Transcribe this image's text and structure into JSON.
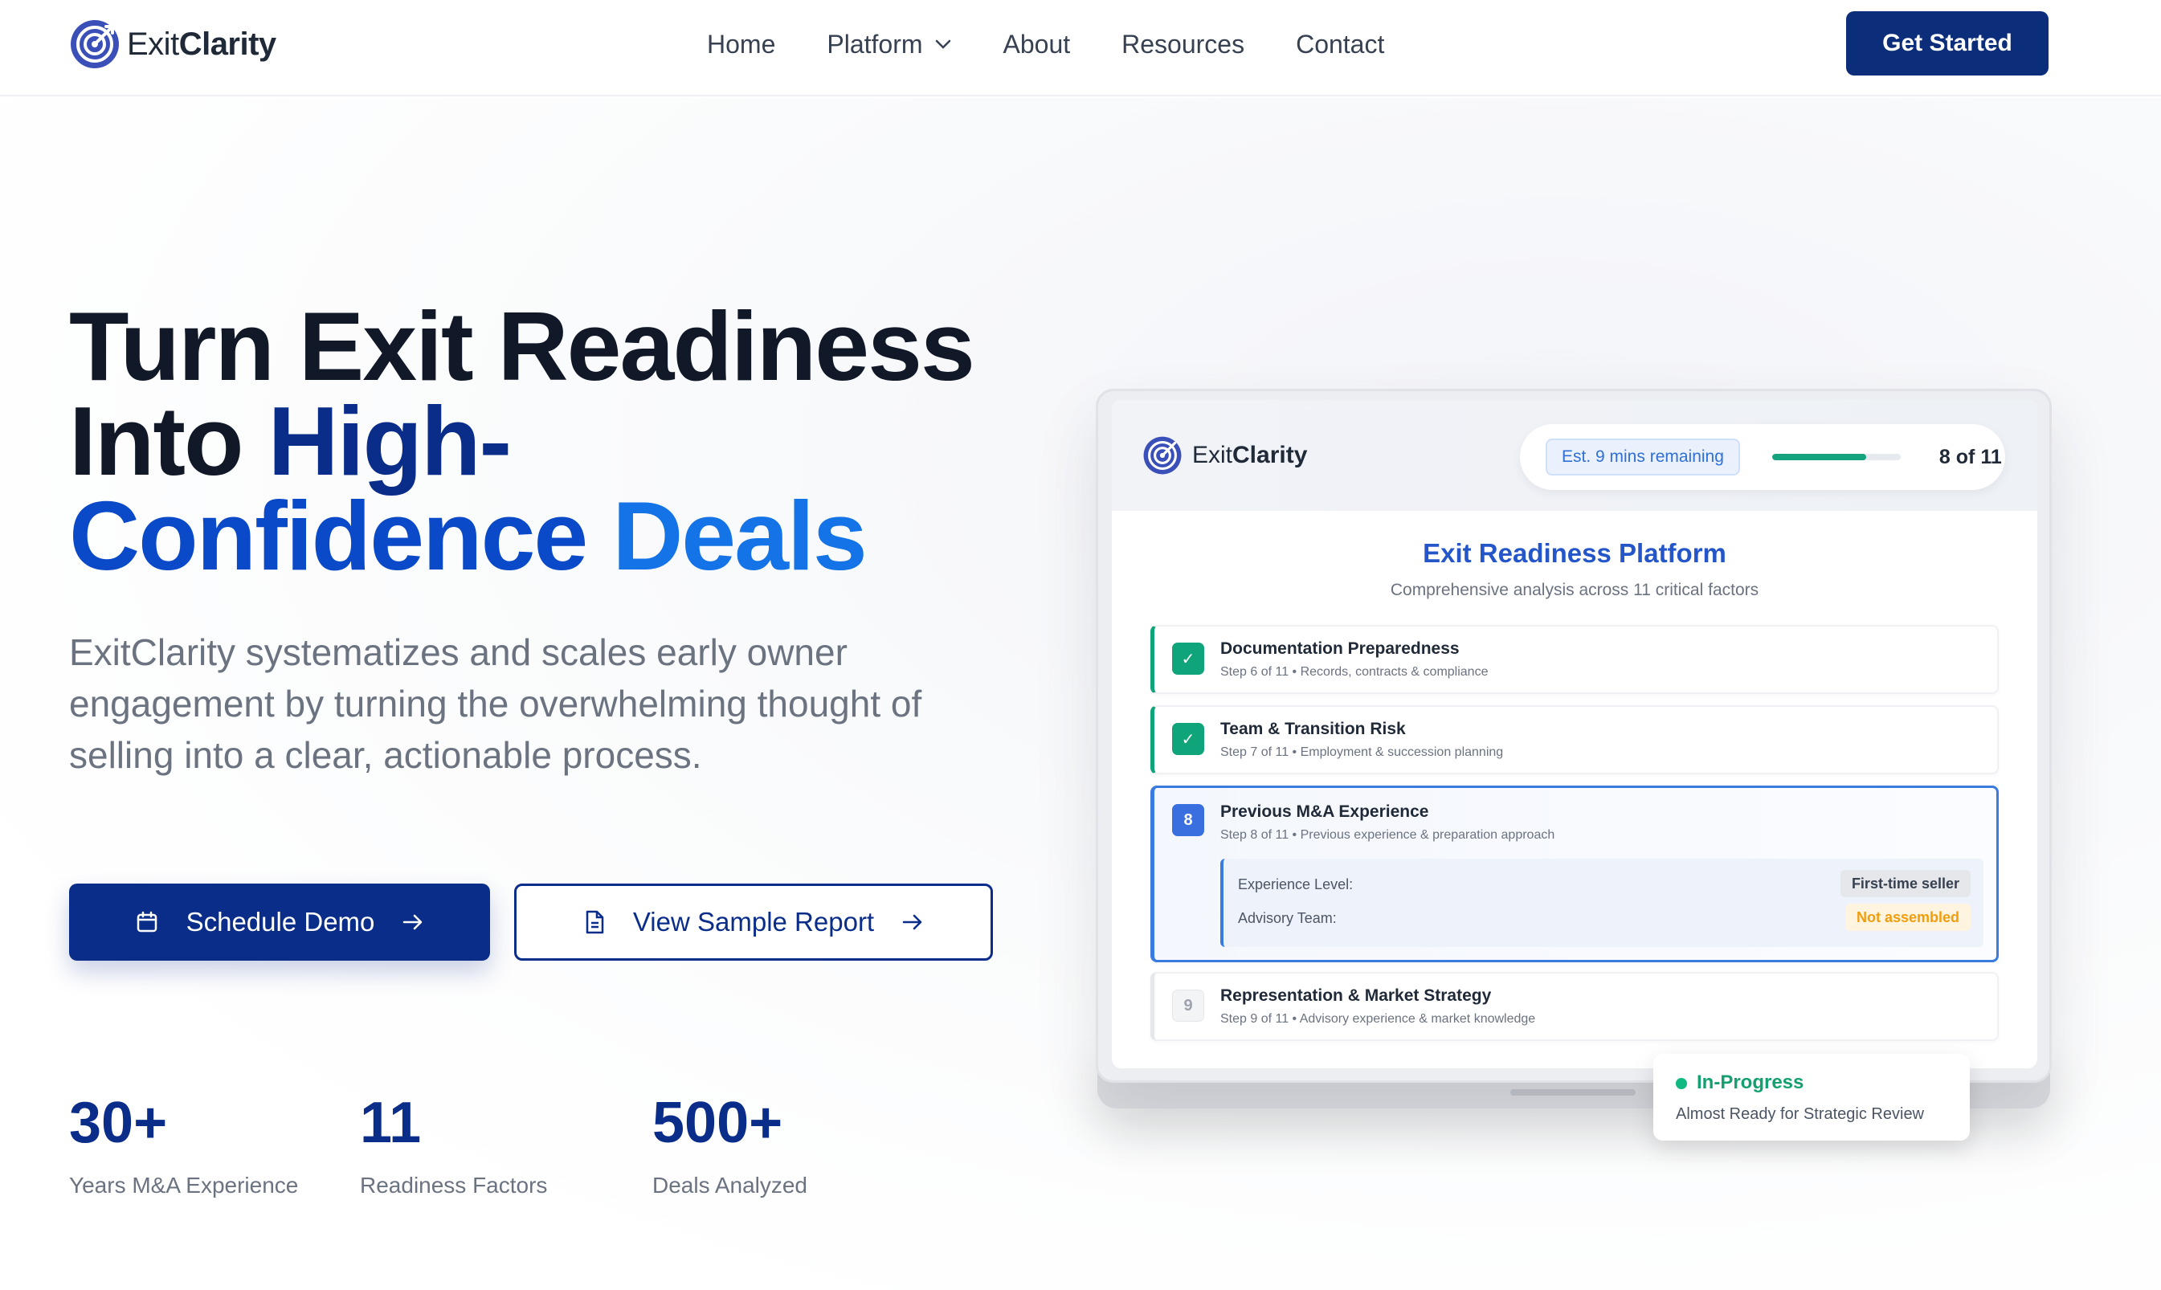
{
  "brand": {
    "name_light": "Exit",
    "name_bold": "Clarity"
  },
  "nav": {
    "items": [
      {
        "label": "Home"
      },
      {
        "label": "Platform"
      },
      {
        "label": "About"
      },
      {
        "label": "Resources"
      },
      {
        "label": "Contact"
      }
    ],
    "cta_label": "Get Started"
  },
  "hero": {
    "headline_line1": "Turn Exit Readiness",
    "headline_line2_plain": "Into ",
    "headline_line2_accent": "High-",
    "headline_line3_a": "Confidence",
    "headline_line3_b": "Deals",
    "subtext": "ExitClarity systematizes and scales early owner engagement by turning the overwhelming thought of selling into a clear, actionable process.",
    "primary_button": "Schedule Demo",
    "secondary_button": "View Sample Report",
    "stats": [
      {
        "value": "30+",
        "label": "Years M&A Experience"
      },
      {
        "value": "11",
        "label": "Readiness Factors"
      },
      {
        "value": "500+",
        "label": "Deals Analyzed"
      }
    ]
  },
  "mockup": {
    "estimate": "Est. 9 mins remaining",
    "progress_fraction": 0.73,
    "step_count": "8 of 11",
    "title": "Exit Readiness Platform",
    "subtitle": "Comprehensive analysis across 11 critical factors",
    "steps": [
      {
        "badge": "✓",
        "title": "Documentation Preparedness",
        "meta": "Step 6 of 11 • Records, contracts & compliance",
        "state": "done"
      },
      {
        "badge": "✓",
        "title": "Team & Transition Risk",
        "meta": "Step 7 of 11 • Employment & succession planning",
        "state": "done"
      },
      {
        "badge": "8",
        "title": "Previous M&A Experience",
        "meta": "Step 8 of 11 • Previous experience & preparation approach",
        "state": "active"
      },
      {
        "badge": "9",
        "title": "Representation & Market Strategy",
        "meta": "Step 9 of 11 • Advisory experience & market knowledge",
        "state": "pending"
      }
    ],
    "details": [
      {
        "label": "Experience Level:",
        "value": "First-time seller"
      },
      {
        "label": "Advisory Team:",
        "value": "Not assembled"
      }
    ],
    "status_title": "In-Progress",
    "status_sub": "Almost Ready for Strategic Review"
  },
  "colors": {
    "brand_navy": "#0b2d8a",
    "accent_blue": "#1473e6",
    "success_green": "#10a47a",
    "warning_orange": "#f29d0c"
  }
}
